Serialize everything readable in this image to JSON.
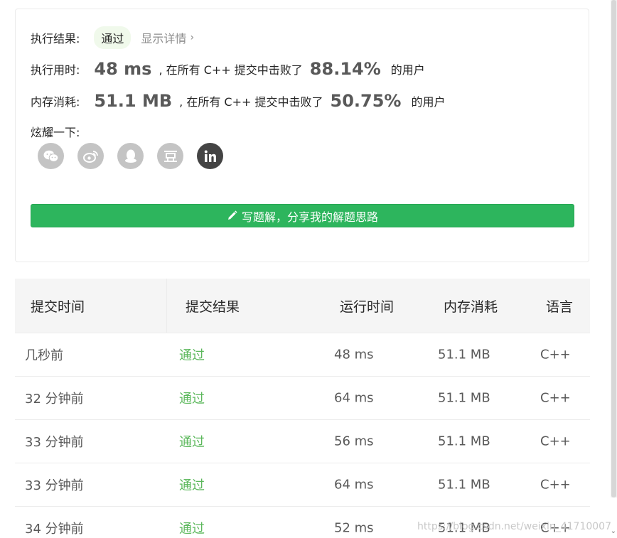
{
  "result": {
    "label": "执行结果:",
    "status": "通过",
    "details": "显示详情"
  },
  "runtime": {
    "label": "执行用时:",
    "value": "48 ms",
    "text": ", 在所有 C++ 提交中击败了",
    "percent": "88.14%",
    "suffix": "的用户"
  },
  "memory": {
    "label": "内存消耗:",
    "value": "51.1 MB",
    "text": ", 在所有 C++ 提交中击败了",
    "percent": "50.75%",
    "suffix": "的用户"
  },
  "share": {
    "label": "炫耀一下:",
    "items": [
      "wechat-icon",
      "weibo-icon",
      "qq-icon",
      "douban-icon",
      "linkedin-icon"
    ]
  },
  "write_button": "写题解，分享我的解题思路",
  "table": {
    "headers": [
      "提交时间",
      "提交结果",
      "运行时间",
      "内存消耗",
      "语言"
    ],
    "rows": [
      {
        "time": "几秒前",
        "status": "通过",
        "runtime": "48 ms",
        "memory": "51.1 MB",
        "lang": "C++"
      },
      {
        "time": "32 分钟前",
        "status": "通过",
        "runtime": "64 ms",
        "memory": "51.1 MB",
        "lang": "C++"
      },
      {
        "time": "33 分钟前",
        "status": "通过",
        "runtime": "56 ms",
        "memory": "51.1 MB",
        "lang": "C++"
      },
      {
        "time": "33 分钟前",
        "status": "通过",
        "runtime": "64 ms",
        "memory": "51.1 MB",
        "lang": "C++"
      },
      {
        "time": "34 分钟前",
        "status": "通过",
        "runtime": "52 ms",
        "memory": "51.1 MB",
        "lang": "C++"
      }
    ]
  },
  "watermark": "https://blog.csdn.net/weixin_41710007",
  "colors": {
    "accent_green": "#2db55d",
    "status_green": "#5cb85c"
  }
}
